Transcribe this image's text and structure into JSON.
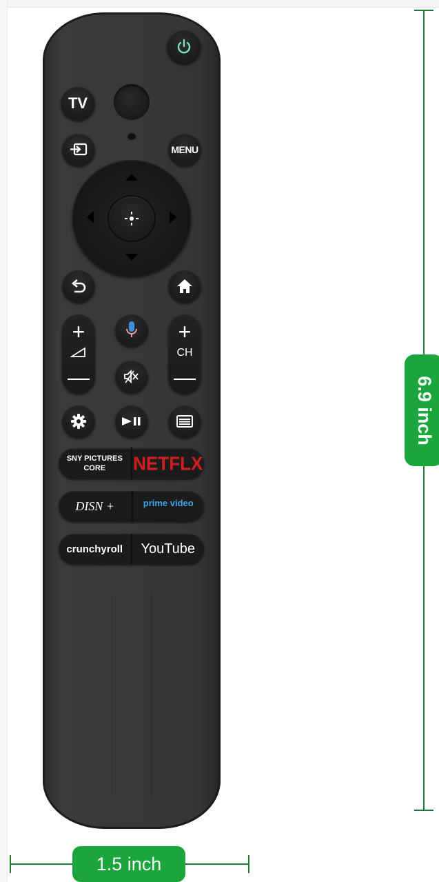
{
  "remote": {
    "tv_label": "TV",
    "menu_label": "MENU",
    "ch_label": "CH",
    "vol_plus": "+",
    "vol_minus": "—",
    "ch_plus": "+",
    "ch_minus": "—"
  },
  "apps": {
    "row1_left": "SNY PICTURES\nCORE",
    "row1_right": "NETFLX",
    "row2_left": "DISN +",
    "row2_right": "prime video",
    "row3_left": "crunchyroll",
    "row3_right": "YouTube"
  },
  "dimensions": {
    "height_label": "6.9 inch",
    "width_label": "1.5 inch"
  },
  "colors": {
    "remote_body": "#383838",
    "button": "#1d1d1d",
    "power_icon": "#7fe0c8",
    "netflix_red": "#d21e1e",
    "prime_blue": "#3ba6e8",
    "dimension_green": "#1aa63c",
    "mic_blue": "#3d8fe0",
    "mic_pink": "#f0a0a0"
  },
  "icons": [
    "power-icon",
    "input-icon",
    "back-icon",
    "home-icon",
    "mic-icon",
    "volume-icon",
    "mute-icon",
    "gear-icon",
    "play-pause-icon",
    "guide-icon",
    "dpad-up-icon",
    "dpad-down-icon",
    "dpad-left-icon",
    "dpad-right-icon",
    "ok-icon"
  ]
}
